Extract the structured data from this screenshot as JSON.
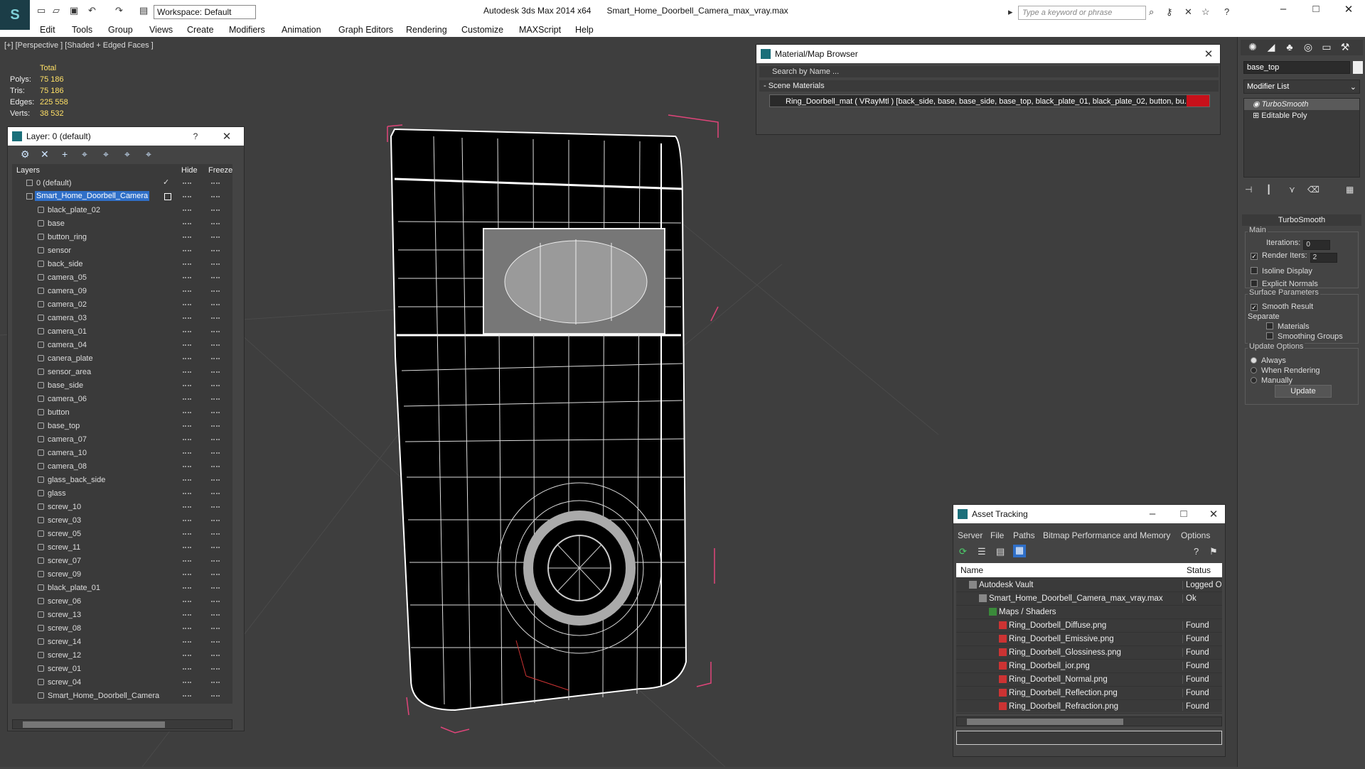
{
  "app": {
    "title": "Autodesk 3ds Max  2014 x64",
    "file": "Smart_Home_Doorbell_Camera_max_vray.max",
    "workspace": "Workspace: Default",
    "search_placeholder": "Type a keyword or phrase"
  },
  "menu": [
    "Edit",
    "Tools",
    "Group",
    "Views",
    "Create",
    "Modifiers",
    "Animation",
    "Graph Editors",
    "Rendering",
    "Customize",
    "MAXScript",
    "Help"
  ],
  "viewport": {
    "label": "[+] [Perspective ] [Shaded + Edged Faces ]",
    "stats": {
      "total_label": "Total",
      "rows": [
        {
          "k": "Polys:",
          "v": "75 186"
        },
        {
          "k": "Tris:",
          "v": "75 186"
        },
        {
          "k": "Edges:",
          "v": "225 558"
        },
        {
          "k": "Verts:",
          "v": "38 532"
        }
      ]
    }
  },
  "layer_panel": {
    "title": "Layer: 0 (default)",
    "help": "?",
    "col_layers": "Layers",
    "col_hide": "Hide",
    "col_freeze": "Freeze",
    "default_layer": "0 (default)",
    "selected_layer": "Smart_Home_Doorbell_Camera",
    "objects": [
      "black_plate_02",
      "base",
      "button_ring",
      "sensor",
      "back_side",
      "camera_05",
      "camera_09",
      "camera_02",
      "camera_03",
      "camera_01",
      "camera_04",
      "canera_plate",
      "sensor_area",
      "base_side",
      "camera_06",
      "button",
      "base_top",
      "camera_07",
      "camera_10",
      "camera_08",
      "glass_back_side",
      "glass",
      "screw_10",
      "screw_03",
      "screw_05",
      "screw_11",
      "screw_07",
      "screw_09",
      "black_plate_01",
      "screw_06",
      "screw_13",
      "screw_08",
      "screw_14",
      "screw_12",
      "screw_01",
      "screw_04",
      "Smart_Home_Doorbell_Camera"
    ]
  },
  "material_browser": {
    "title": "Material/Map Browser",
    "search": "Search by Name ...",
    "section": "- Scene Materials",
    "item": "Ring_Doorbell_mat ( VRayMtl ) [back_side, base, base_side, base_top, black_plate_01, black_plate_02, button, bu..."
  },
  "command_panel": {
    "object_name": "base_top",
    "modifier_list": "Modifier List",
    "stack": [
      "TurboSmooth",
      "Editable Poly"
    ],
    "rollout": "TurboSmooth",
    "main_label": "Main",
    "iterations_label": "Iterations:",
    "iterations_value": "0",
    "render_iters_label": "Render Iters:",
    "render_iters_value": "2",
    "render_iters_checked": true,
    "isoline": "Isoline Display",
    "explicit": "Explicit Normals",
    "surface_params": "Surface Parameters",
    "smooth_result": "Smooth Result",
    "separate": "Separate",
    "materials": "Materials",
    "smoothing_groups": "Smoothing Groups",
    "update_options": "Update Options",
    "always": "Always",
    "when_rendering": "When Rendering",
    "manually": "Manually",
    "update_btn": "Update"
  },
  "asset_tracking": {
    "title": "Asset Tracking",
    "menu": [
      "Server",
      "File",
      "Paths",
      "Bitmap Performance and Memory",
      "Options"
    ],
    "col_name": "Name",
    "col_status": "Status",
    "rows": [
      {
        "name": "Autodesk Vault",
        "status": "Logged Out",
        "indent": 1
      },
      {
        "name": "Smart_Home_Doorbell_Camera_max_vray.max",
        "status": "Ok",
        "indent": 2
      },
      {
        "name": "Maps / Shaders",
        "status": "",
        "indent": 3
      },
      {
        "name": "Ring_Doorbell_Diffuse.png",
        "status": "Found",
        "indent": 4
      },
      {
        "name": "Ring_Doorbell_Emissive.png",
        "status": "Found",
        "indent": 4
      },
      {
        "name": "Ring_Doorbell_Glossiness.png",
        "status": "Found",
        "indent": 4
      },
      {
        "name": "Ring_Doorbell_ior.png",
        "status": "Found",
        "indent": 4
      },
      {
        "name": "Ring_Doorbell_Normal.png",
        "status": "Found",
        "indent": 4
      },
      {
        "name": "Ring_Doorbell_Reflection.png",
        "status": "Found",
        "indent": 4
      },
      {
        "name": "Ring_Doorbell_Refraction.png",
        "status": "Found",
        "indent": 4
      }
    ]
  },
  "colors": {
    "selection": "#2f6fc8",
    "stats_value": "#ffe066",
    "bbox": "#e0457a"
  }
}
